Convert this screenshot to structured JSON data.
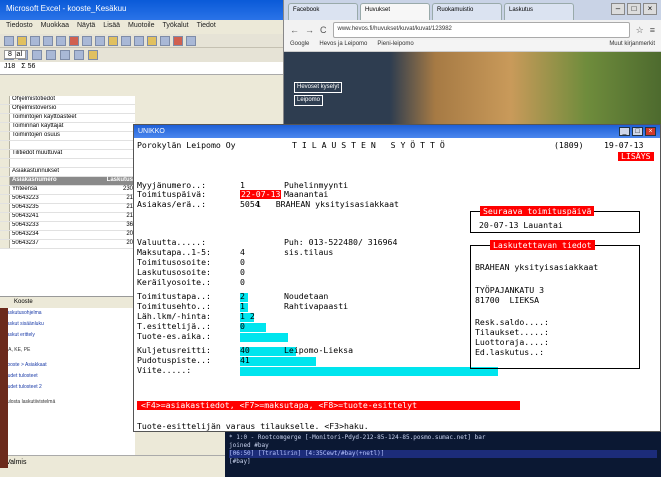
{
  "excel": {
    "title": "Microsoft Excel - kooste_Kesäkuu",
    "menu": [
      "Tiedosto",
      "Muokkaa",
      "Näytä",
      "Lisää",
      "Muotoile",
      "Työkalut",
      "Tiedot"
    ],
    "font_name": "Arial",
    "font_size": "8",
    "name_box": "J18",
    "formula": "Σ 56",
    "sheet_rows": [
      {
        "label": "Ohjelmistotiedot",
        "value": ""
      },
      {
        "label": "Ohjelmistoversio",
        "value": ""
      },
      {
        "label": "Toimintojen käyttöasteet",
        "value": ""
      },
      {
        "label": "Toiminnan käyttäjät",
        "value": ""
      },
      {
        "label": "Toimintojen osuus",
        "value": ""
      },
      {
        "label": "",
        "value": ""
      },
      {
        "label": "Tilitiedot muuttuvat",
        "value": ""
      },
      {
        "label": "",
        "value": ""
      },
      {
        "label": "Asiakastunnukset",
        "value": ""
      },
      {
        "label": "Asiakasnumero",
        "value": "Laskutus",
        "head": true
      },
      {
        "label": "Yhteensä",
        "value": "230"
      },
      {
        "label": "50643223",
        "value": "21"
      },
      {
        "label": "50643235",
        "value": "21"
      },
      {
        "label": "50643241",
        "value": "21"
      },
      {
        "label": "50643233",
        "value": "36"
      },
      {
        "label": "50643234",
        "value": "20"
      },
      {
        "label": "50643237",
        "value": "20"
      }
    ],
    "sheet_tab": "Kooste",
    "left_notes": [
      "Laskutusohjelma",
      "Laskut sisäänluku",
      "Laskut erittely",
      "",
      "MA, KE, PE",
      "",
      "Kooste > Asiakkaat",
      "Uudet tulosteet",
      "Uudet tulosteet 2",
      "",
      "Tulosta laskutiivistelmä"
    ],
    "status": "Valmis"
  },
  "browser": {
    "tabs": [
      "Facebook",
      "Huvukset",
      "Ruokamuistio",
      "Laskutus"
    ],
    "url": "www.hevos.fi/huvukset/kuvat/kuvat/123982",
    "bookmarks": [
      "Google",
      "Hevos ja Leipomo",
      "Pieni-leipomo",
      "Muut kirjanmerkit"
    ],
    "site_lines": [
      "Hevoset kyselyt",
      "Leipomo"
    ]
  },
  "terminal": {
    "title": "UNIKKO",
    "company": "Porokylän Leipomo Oy",
    "screen_title": "T I L A U S T E N   S Y Ö T T Ö",
    "counter": "(1809)",
    "date": "19-07-13",
    "status_flag": "LISÄYS",
    "rows": [
      {
        "label": "Myyjänumero..:",
        "value": "1",
        "extra": "Puhelinmyynti"
      },
      {
        "label": "Toimituspäivä:",
        "value": "22-07-13",
        "extra": "Maanantai"
      },
      {
        "label": "Asiakas/erä..:",
        "value": "5054",
        "extra": "1   BRAHEAN yksityisasiakkaat"
      },
      {
        "label": "Valuutta.....:",
        "value": "",
        "extra": "Puh: 013-522480/ 316964"
      },
      {
        "label": "Maksutapa..1-5:",
        "value": "4",
        "extra": "sis.tilaus"
      },
      {
        "label": "Toimitusosoite:",
        "value": "0",
        "extra": ""
      },
      {
        "label": "Laskutusosoite:",
        "value": "0",
        "extra": ""
      },
      {
        "label": "Keräilyosoite.:",
        "value": "0",
        "extra": ""
      },
      {
        "label": "Toimitustapa..:",
        "value": "2",
        "extra": "Noudetaan"
      },
      {
        "label": "Toimitusehto..:",
        "value": "1",
        "extra": "Rahtivapaasti"
      },
      {
        "label": "Läh.lkm/-hinta:",
        "value": "1 2",
        "extra": ""
      },
      {
        "label": "T.esittelijä..:",
        "value": "0",
        "extra": ""
      },
      {
        "label": "Tuote-es.aika.:",
        "value": "",
        "extra": ""
      },
      {
        "label": "Kuljetusreitti:",
        "value": "40",
        "extra": "Leipomo-Lieksa"
      },
      {
        "label": "Pudotuspiste..:",
        "value": "41",
        "extra": ""
      },
      {
        "label": "Viite.....:",
        "value": "",
        "extra": ""
      }
    ],
    "next_delivery": {
      "label": "Seuraava toimituspäivä",
      "value": "20-07-13 Lauantai"
    },
    "billing": {
      "label": "Laskutettavan tiedot",
      "name": "BRAHEAN yksityisasiakkaat",
      "street": "TYÖPAJANKATU 3",
      "postal": "81700  LIEKSA",
      "fields": [
        "Resk.saldo....:",
        "Tilaukset.....:",
        "Luottoraja....:",
        "Ed.laskutus..:"
      ]
    },
    "function_keys": "<F4>=asiakastiedot, <F7>=maksutapa, <F8>=tuote-esittelyt",
    "footer": "Tuote-esittelijän varaus tilaukselle. <F3>haku."
  },
  "shell": {
    "lines": [
      "* 1:0 -  Rootcomgerge  [-Monitori-Pdyd-212-85-124-85.posmo.sumac.net]  bar",
      "                 joined #bay",
      "[06:50] [Ttrallirin] [4:35Cewt/#bay(+netl)]",
      "[#bay]"
    ]
  },
  "colors": {
    "accent_red": "#ff0000",
    "accent_cyan": "#00e5ee",
    "titlebar_blue": "#1e5fd6"
  }
}
